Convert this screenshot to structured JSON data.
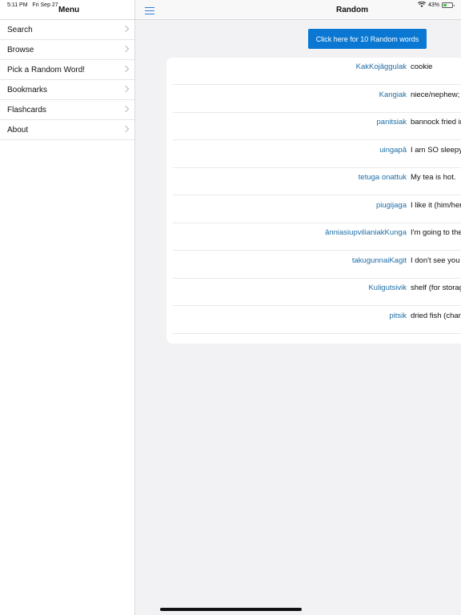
{
  "status": {
    "time": "5:11 PM",
    "date": "Fri Sep 27",
    "battery_percent": "43%",
    "battery_level": 0.43
  },
  "sidebar": {
    "title": "Menu",
    "items": [
      {
        "label": "Search"
      },
      {
        "label": "Browse"
      },
      {
        "label": "Pick a Random Word!"
      },
      {
        "label": "Bookmarks"
      },
      {
        "label": "Flashcards"
      },
      {
        "label": "About"
      }
    ]
  },
  "navbar": {
    "title": "Random"
  },
  "random_button": {
    "label": "Click here for 10 Random words"
  },
  "words": [
    {
      "term": "KakKojâggulak",
      "definition": "cookie"
    },
    {
      "term": "Kangiak",
      "definition": "niece/nephew; what my father's brother calls me [male as"
    },
    {
      "term": "panitsiak",
      "definition": "bannock fried in oil (also sometimes sanamajuk or u"
    },
    {
      "term": "uingapâ",
      "definition": "I am SO sleepy."
    },
    {
      "term": "tetuga onattuk",
      "definition": "My tea is hot."
    },
    {
      "term": "piugijaga",
      "definition": "I like it (him/her)."
    },
    {
      "term": "ânniasiupvilianiakKunga",
      "definition": "I'm going to the hospital after (lat"
    },
    {
      "term": "takugunnaiKagit",
      "definition": "I don't see you anymore (you've disappeared fro"
    },
    {
      "term": "Kuligutsivik",
      "definition": "shelf (for storage)"
    },
    {
      "term": "pitsik",
      "definition": "dried fish (char or cod/rock cod)"
    }
  ]
}
